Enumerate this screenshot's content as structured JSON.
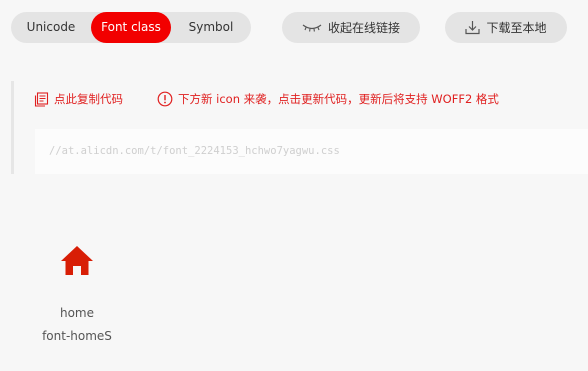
{
  "toolbar": {
    "tabs": [
      {
        "label": "Unicode",
        "active": false
      },
      {
        "label": "Font class",
        "active": true
      },
      {
        "label": "Symbol",
        "active": false
      }
    ],
    "collapse_label": "收起在线链接",
    "collapse_icon": "eye-closed-icon",
    "download_label": "下载至本地",
    "download_icon": "download-icon"
  },
  "code_panel": {
    "copy_label": "点此复制代码",
    "copy_icon": "copy-icon",
    "notice_label": "下方新 icon 来袭，点击更新代码，更新后将支持 WOFF2 格式",
    "notice_icon": "alert-circle-icon",
    "code_text": "//at.alicdn.com/t/font_2224153_hchwo7yagwu.css"
  },
  "icons": [
    {
      "name": "home",
      "class_name": "font-homeS",
      "icon": "home-icon"
    }
  ],
  "colors": {
    "accent": "#f20000",
    "hint_text": "#e02020",
    "home_icon": "#d81e06"
  }
}
